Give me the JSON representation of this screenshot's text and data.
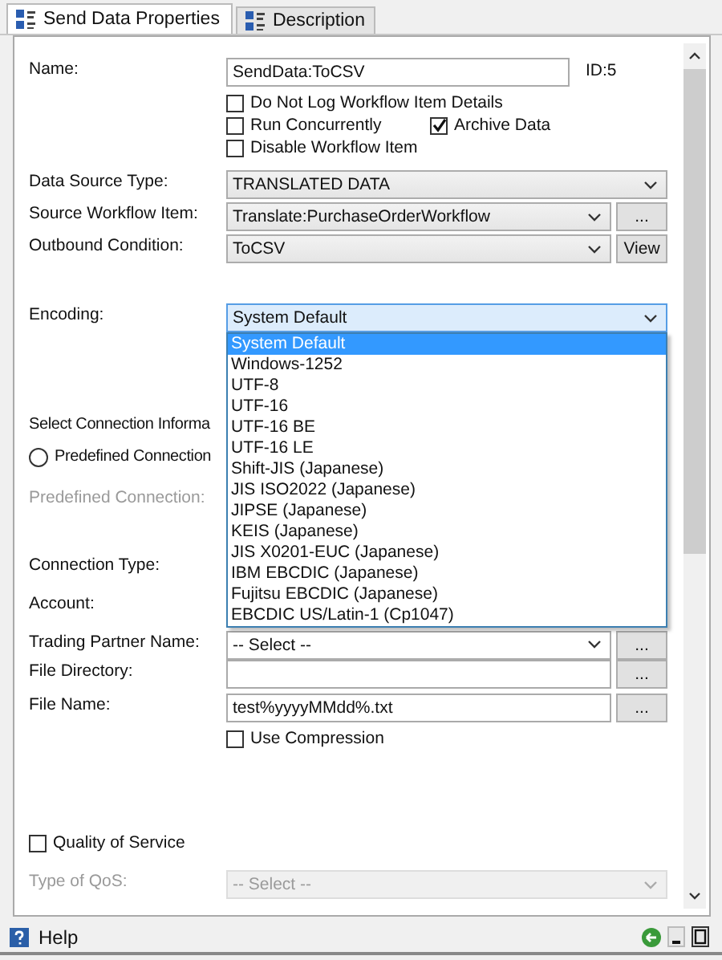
{
  "tabs": [
    {
      "label": "Send Data Properties",
      "selected": true
    },
    {
      "label": "Description",
      "selected": false
    }
  ],
  "name": {
    "label": "Name:",
    "value": "SendData:ToCSV",
    "id": "ID:5"
  },
  "options": [
    {
      "label": "Do Not Log Workflow Item Details",
      "checked": false
    },
    {
      "label": "Run Concurrently",
      "checked": false
    },
    {
      "label": "Archive Data",
      "checked": true
    },
    {
      "label": "Disable Workflow Item",
      "checked": false
    }
  ],
  "data_source_type": {
    "label": "Data Source Type:",
    "value": "TRANSLATED DATA"
  },
  "source_workflow_item": {
    "label": "Source Workflow Item:",
    "value": "Translate:PurchaseOrderWorkflow",
    "button": "..."
  },
  "outbound_condition": {
    "label": "Outbound Condition:",
    "value": "ToCSV",
    "button": "View"
  },
  "encoding": {
    "label": "Encoding:",
    "value": "System Default",
    "options": [
      {
        "label": "System Default",
        "selected": true
      },
      {
        "label": "Windows-1252",
        "selected": false
      },
      {
        "label": "UTF-8",
        "selected": false
      },
      {
        "label": "UTF-16",
        "selected": false
      },
      {
        "label": "UTF-16 BE",
        "selected": false
      },
      {
        "label": "UTF-16 LE",
        "selected": false
      },
      {
        "label": "Shift-JIS (Japanese)",
        "selected": false
      },
      {
        "label": "JIS ISO2022 (Japanese)",
        "selected": false
      },
      {
        "label": "JIPSE (Japanese)",
        "selected": false
      },
      {
        "label": "KEIS (Japanese)",
        "selected": false
      },
      {
        "label": "JIS X0201-EUC (Japanese)",
        "selected": false
      },
      {
        "label": "IBM EBCDIC (Japanese)",
        "selected": false
      },
      {
        "label": "Fujitsu EBCDIC (Japanese)",
        "selected": false
      },
      {
        "label": "EBCDIC US/Latin-1 (Cp1047)",
        "selected": false
      }
    ]
  },
  "connection": {
    "heading": "Select Connection Informa",
    "radio": {
      "label": "Predefined Connection",
      "selected": false
    },
    "predefined": {
      "label": "Predefined Connection:",
      "disabled": true
    },
    "connection_type_label": "Connection Type:",
    "account_label": "Account:"
  },
  "trading_partner": {
    "label": "Trading Partner Name:",
    "value": "-- Select --",
    "button": "..."
  },
  "file_directory": {
    "label": "File Directory:",
    "button": "..."
  },
  "file_name": {
    "label": "File Name:",
    "value": "test%yyyyMMdd%.txt",
    "button": "..."
  },
  "use_compression": {
    "label": "Use Compression",
    "checked": false
  },
  "quality_of_service": {
    "label": "Quality of Service",
    "checked": false
  },
  "qos_type": {
    "label": "Type of QoS:",
    "value": "-- Select --",
    "disabled": true
  },
  "help": "Help"
}
